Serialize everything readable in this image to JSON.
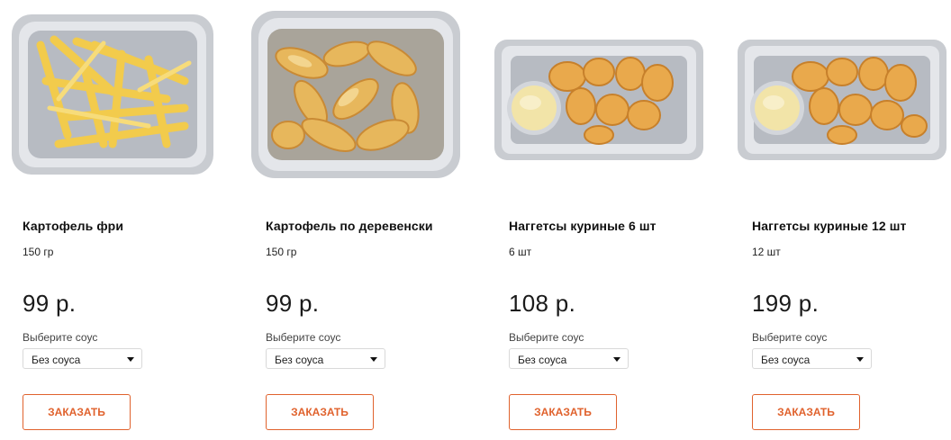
{
  "colors": {
    "accent": "#e0622d",
    "select_border": "#d9d9d9"
  },
  "products": [
    {
      "title": "Картофель фри",
      "weight": "150 гр",
      "price": "99 р.",
      "sauce_label": "Выберите соус",
      "sauce_selected": "Без соуса",
      "order_label": "ЗАКАЗАТЬ",
      "image_icon": "french-fries-tray-image"
    },
    {
      "title": "Картофель по деревенски",
      "weight": "150 гр",
      "price": "99 р.",
      "sauce_label": "Выберите соус",
      "sauce_selected": "Без соуса",
      "order_label": "ЗАКАЗАТЬ",
      "image_icon": "potato-wedges-tray-image"
    },
    {
      "title": "Наггетсы куриные 6 шт",
      "weight": "6 шт",
      "price": "108 р.",
      "sauce_label": "Выберите соус",
      "sauce_selected": "Без соуса",
      "order_label": "ЗАКАЗАТЬ",
      "image_icon": "chicken-nuggets-tray-image"
    },
    {
      "title": "Наггетсы куриные 12 шт",
      "weight": "12 шт",
      "price": "199 р.",
      "sauce_label": "Выберите соус",
      "sauce_selected": "Без соуса",
      "order_label": "ЗАКАЗАТЬ",
      "image_icon": "chicken-nuggets-tray-image"
    }
  ]
}
